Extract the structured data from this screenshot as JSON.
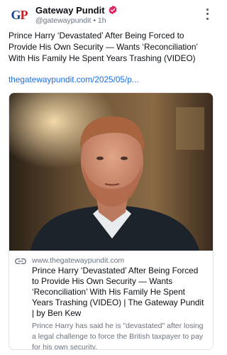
{
  "post": {
    "author": {
      "name": "Gateway Pundit",
      "handle": "@gatewaypundit",
      "separator": "•",
      "time": "1h",
      "avatar_text_g": "G",
      "avatar_text_p": "P"
    },
    "text": "Prince Harry ‘Devastated’ After Being Forced to Provide His Own Security — Wants ‘Reconciliation’ With His Family He Spent Years Trashing (VIDEO)",
    "link": "thegatewaypundit.com/2025/05/p...",
    "embed": {
      "domain": "www.thegatewaypundit.com",
      "title": "Prince Harry ‘Devastated’ After Being Forced to Provide His Own Security — Wants ‘Reconciliation’ With His Family He Spent Years Trashing (VIDEO) | The Gateway Pundit | by Ben Kew",
      "description": "Prince Harry has said he is \"devastated\" after losing a legal challenge to force the British taxpayer to pay for his own security."
    }
  },
  "icons": {
    "verified": "verified-badge-icon",
    "more": "more-options-icon",
    "link": "link-icon"
  },
  "colors": {
    "verified_badge": "#e0245e",
    "link": "#1d6fe0",
    "logo_blue": "#1b3f8f",
    "logo_red": "#c62026",
    "muted_text": "#6b7380"
  }
}
